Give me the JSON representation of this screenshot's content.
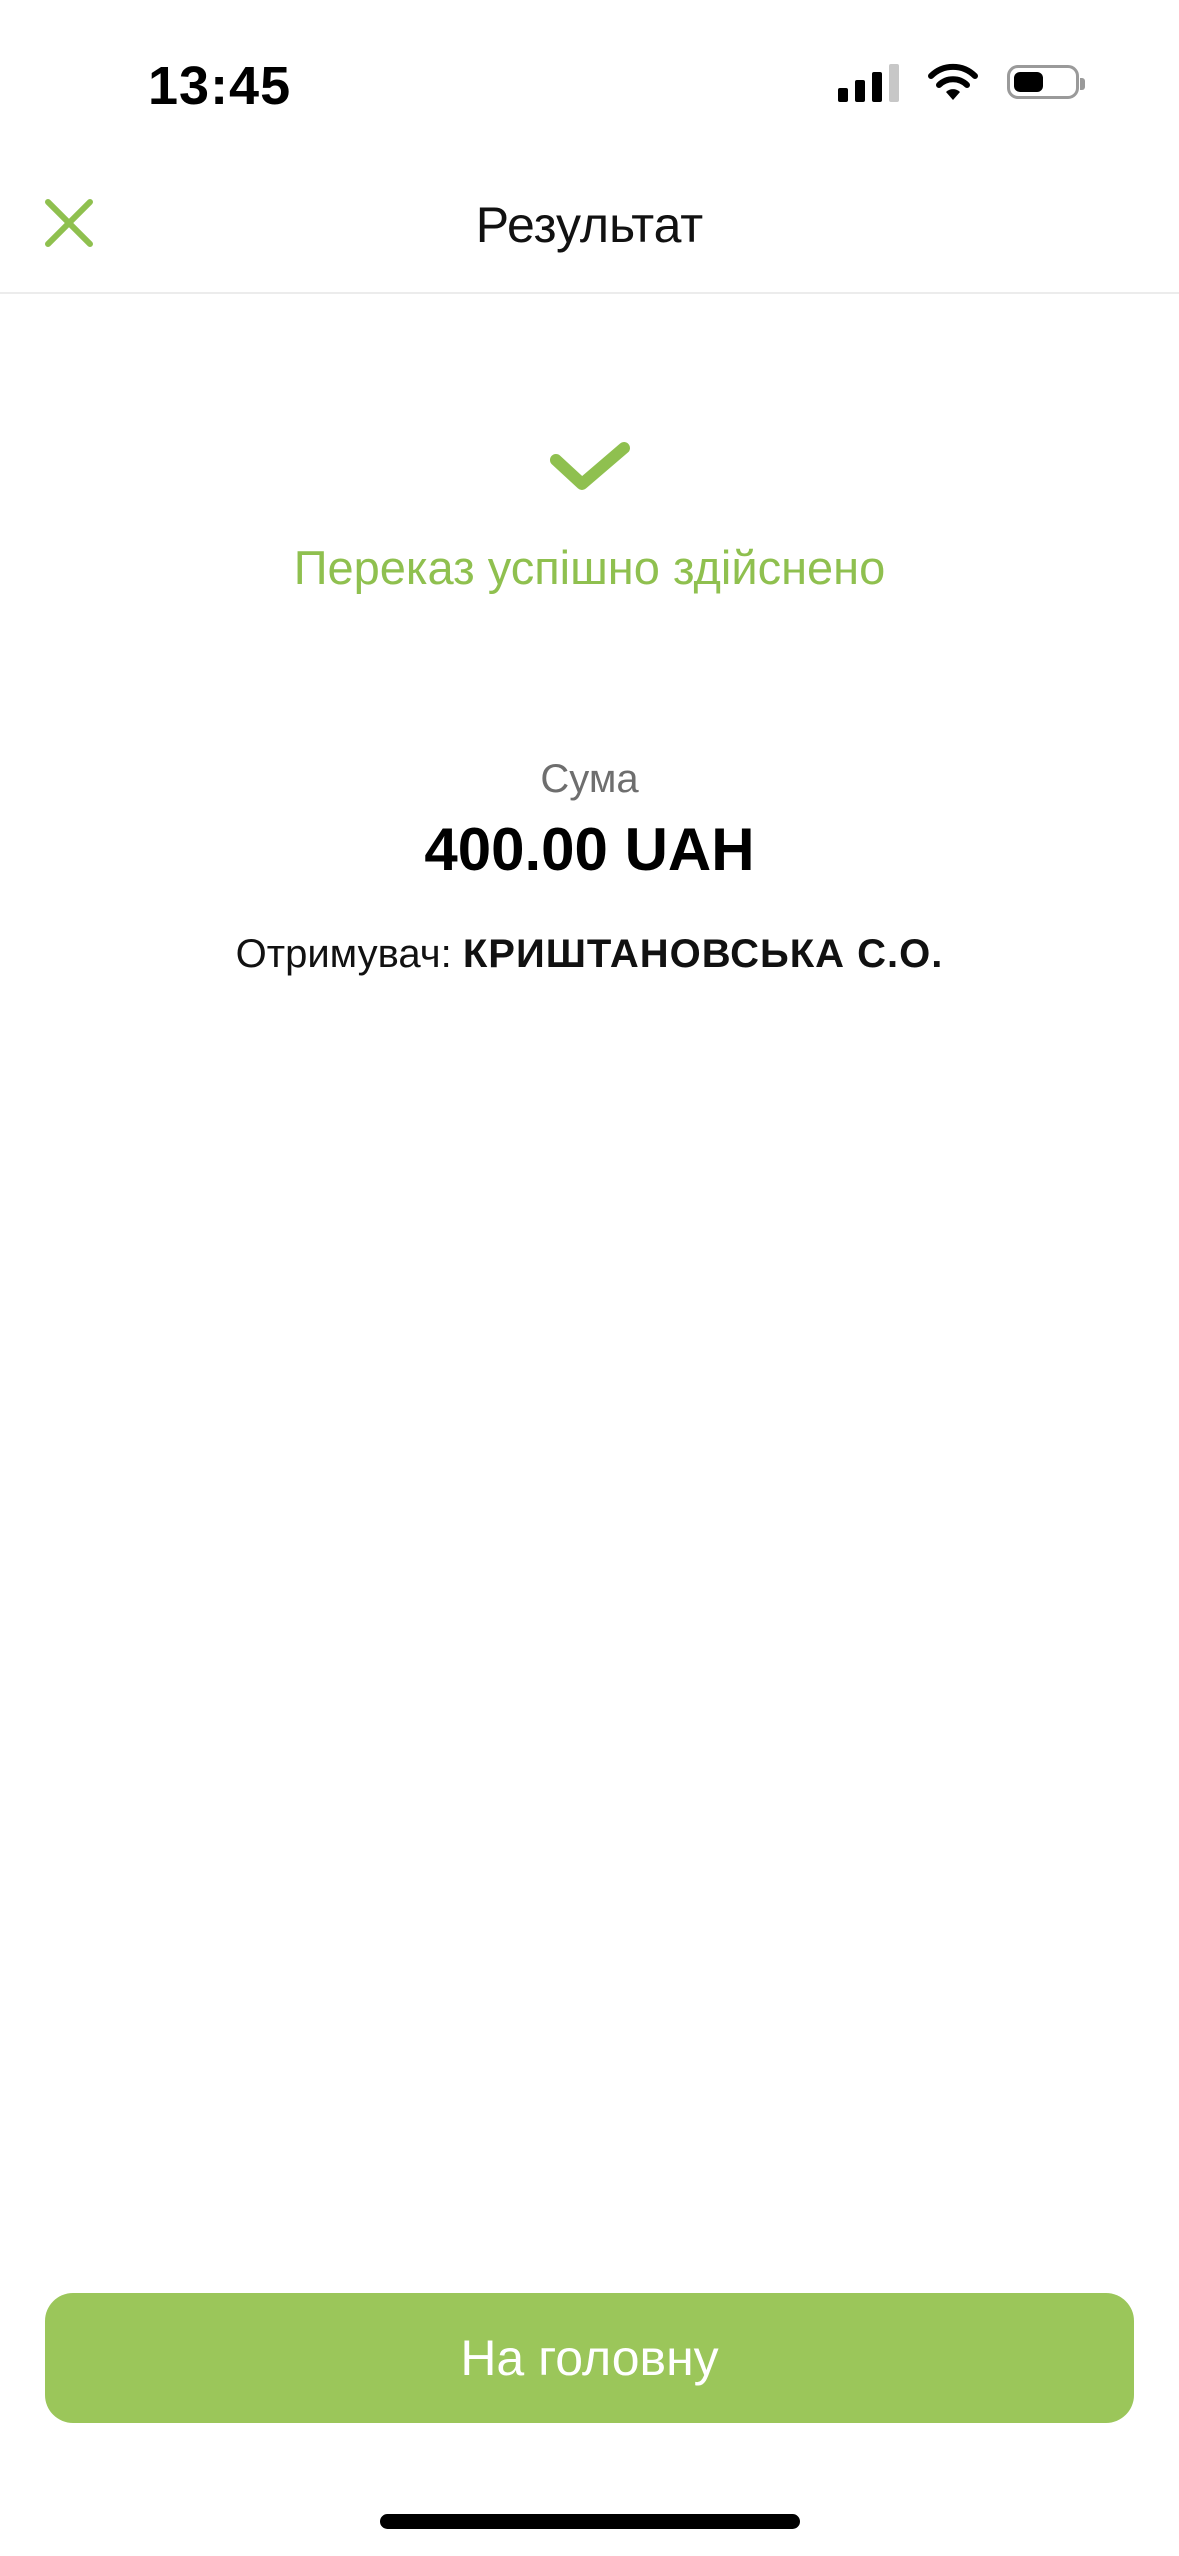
{
  "status_bar": {
    "time": "13:45",
    "icons": [
      "cellular-signal-icon",
      "wifi-icon",
      "battery-icon"
    ],
    "battery_level": 0.5
  },
  "header": {
    "title": "Результат",
    "close_icon": "close-icon"
  },
  "result": {
    "icon": "checkmark-icon",
    "message": "Переказ успішно здійснено",
    "amount_label": "Сума",
    "amount_value": "400.00 UAH",
    "recipient_label": "Отримувач:",
    "recipient_name": "КРИШТАНОВСЬКА С.О."
  },
  "actions": {
    "home_label": "На головну"
  },
  "colors": {
    "accent": "#9bc65a",
    "success_text": "#8fc04f",
    "secondary_text": "#6e6e6e"
  }
}
